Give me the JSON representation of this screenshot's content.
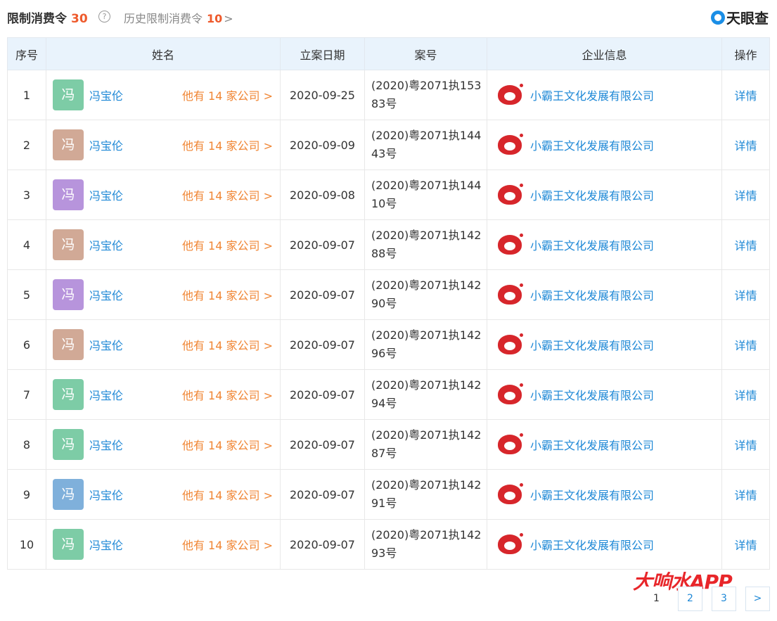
{
  "header": {
    "title": "限制消费令",
    "count": "30",
    "help": "?",
    "history_label": "历史限制消费令",
    "history_count": "10",
    "history_chevron": ">",
    "brand": "天眼查"
  },
  "columns": [
    "序号",
    "姓名",
    "立案日期",
    "案号",
    "企业信息",
    "操作"
  ],
  "rows": [
    {
      "idx": "1",
      "avatar": "冯",
      "avatar_color": "#7dcca6",
      "name": "冯宝伦",
      "companies": "他有 14 家公司 >",
      "date": "2020-09-25",
      "case": "(2020)粤2071执15383号",
      "company": "小霸王文化发展有限公司",
      "action": "详情"
    },
    {
      "idx": "2",
      "avatar": "冯",
      "avatar_color": "#d1a996",
      "name": "冯宝伦",
      "companies": "他有 14 家公司 >",
      "date": "2020-09-09",
      "case": "(2020)粤2071执14443号",
      "company": "小霸王文化发展有限公司",
      "action": "详情"
    },
    {
      "idx": "3",
      "avatar": "冯",
      "avatar_color": "#b794dc",
      "name": "冯宝伦",
      "companies": "他有 14 家公司 >",
      "date": "2020-09-08",
      "case": "(2020)粤2071执14410号",
      "company": "小霸王文化发展有限公司",
      "action": "详情"
    },
    {
      "idx": "4",
      "avatar": "冯",
      "avatar_color": "#d1a996",
      "name": "冯宝伦",
      "companies": "他有 14 家公司 >",
      "date": "2020-09-07",
      "case": "(2020)粤2071执14288号",
      "company": "小霸王文化发展有限公司",
      "action": "详情"
    },
    {
      "idx": "5",
      "avatar": "冯",
      "avatar_color": "#b794dc",
      "name": "冯宝伦",
      "companies": "他有 14 家公司 >",
      "date": "2020-09-07",
      "case": "(2020)粤2071执14290号",
      "company": "小霸王文化发展有限公司",
      "action": "详情"
    },
    {
      "idx": "6",
      "avatar": "冯",
      "avatar_color": "#d1a996",
      "name": "冯宝伦",
      "companies": "他有 14 家公司 >",
      "date": "2020-09-07",
      "case": "(2020)粤2071执14296号",
      "company": "小霸王文化发展有限公司",
      "action": "详情"
    },
    {
      "idx": "7",
      "avatar": "冯",
      "avatar_color": "#7dcca6",
      "name": "冯宝伦",
      "companies": "他有 14 家公司 >",
      "date": "2020-09-07",
      "case": "(2020)粤2071执14294号",
      "company": "小霸王文化发展有限公司",
      "action": "详情"
    },
    {
      "idx": "8",
      "avatar": "冯",
      "avatar_color": "#7dcca6",
      "name": "冯宝伦",
      "companies": "他有 14 家公司 >",
      "date": "2020-09-07",
      "case": "(2020)粤2071执14287号",
      "company": "小霸王文化发展有限公司",
      "action": "详情"
    },
    {
      "idx": "9",
      "avatar": "冯",
      "avatar_color": "#7fb0db",
      "name": "冯宝伦",
      "companies": "他有 14 家公司 >",
      "date": "2020-09-07",
      "case": "(2020)粤2071执14291号",
      "company": "小霸王文化发展有限公司",
      "action": "详情"
    },
    {
      "idx": "10",
      "avatar": "冯",
      "avatar_color": "#7dcca6",
      "name": "冯宝伦",
      "companies": "他有 14 家公司 >",
      "date": "2020-09-07",
      "case": "(2020)粤2071执14293号",
      "company": "小霸王文化发展有限公司",
      "action": "详情"
    }
  ],
  "pagination": {
    "current": "1",
    "pages": [
      "2",
      "3"
    ],
    "next": ">"
  },
  "watermark": "大响水APP"
}
